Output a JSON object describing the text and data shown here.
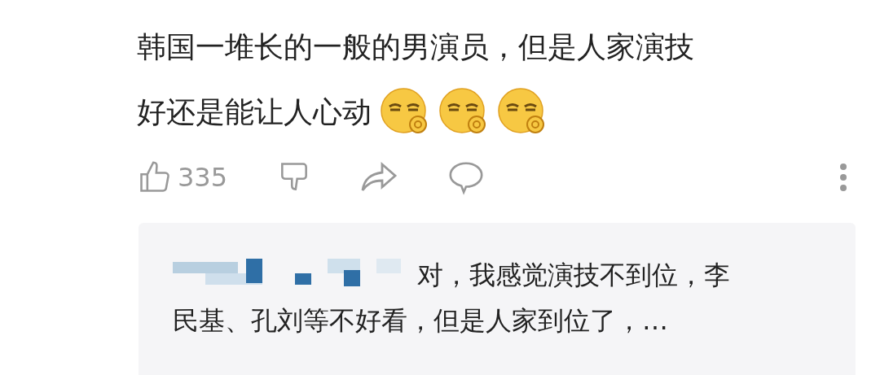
{
  "comment": {
    "text_line_1": "韩国一堆长的一般的男演员，但是人家演技",
    "text_line_2": "好还是能让人心动",
    "emojis": [
      {
        "kind": "emoji"
      },
      {
        "kind": "emoji"
      },
      {
        "kind": "emoji"
      }
    ]
  },
  "actions": {
    "like_count": "335"
  },
  "reply": {
    "text_line_1": "对，我感觉演技不到位，李",
    "text_line_2": "民基、孔刘等不好看，但是人家到位了，…"
  }
}
